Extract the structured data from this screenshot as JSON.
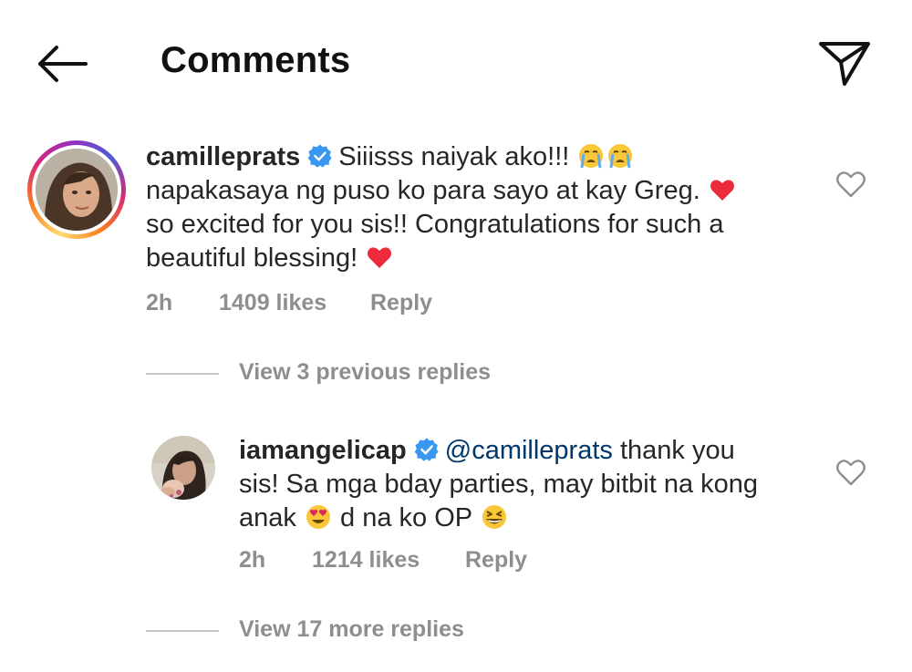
{
  "header": {
    "title": "Comments",
    "back_icon": "arrow-left-icon",
    "send_icon": "paper-plane-icon"
  },
  "comments": [
    {
      "username": "camilleprats",
      "verified": true,
      "text_line1": "Siiisss naiyak ako!!!",
      "text_line2": "napakasaya ng puso ko para sayo at kay Greg.",
      "text_line3": "so excited for you sis!! Congratulations for such a",
      "text_line4": "beautiful blessing!",
      "time": "2h",
      "likes": "1409 likes",
      "reply_label": "Reply"
    },
    {
      "username": "iamangelicap",
      "verified": true,
      "mention": "@camilleprats",
      "text_line1": " thank you",
      "text_line2": "sis! Sa mga bday parties, may bitbit na kong",
      "text_line3a": "anak",
      "text_line3b": " d na ko OP",
      "time": "2h",
      "likes": "1214 likes",
      "reply_label": "Reply"
    }
  ],
  "view_previous_replies": "View 3 previous replies",
  "view_more_replies": "View 17 more replies",
  "colors": {
    "text": "#262626",
    "meta": "#8e8e8e",
    "verified": "#3897f0",
    "mention": "#00376b",
    "heart_red": "#ed2b3c"
  }
}
